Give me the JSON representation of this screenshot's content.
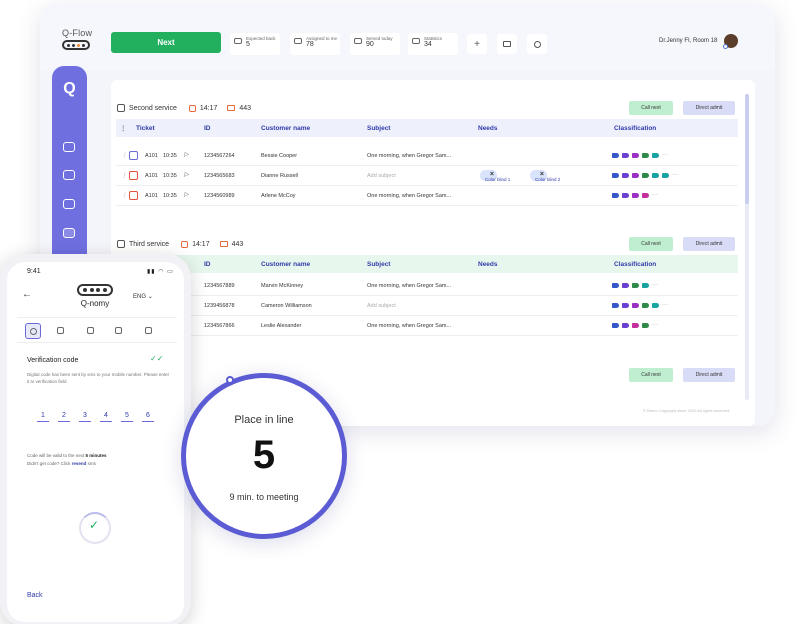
{
  "app": {
    "brand": "Q-Flow",
    "next_label": "Next",
    "stats": [
      {
        "label": "Expected back",
        "value": "5"
      },
      {
        "label": "Assigned to me",
        "value": "78"
      },
      {
        "label": "Served today",
        "value": "90"
      },
      {
        "label": "Statistics",
        "value": "34"
      }
    ],
    "plus_icon": "+",
    "user": "Dr.Jenny FI, Room 18",
    "sidebar_logo": "Q"
  },
  "services": [
    {
      "name": "Second service",
      "time": "14:17",
      "count": "443",
      "call_next": "Call next",
      "direct_admit": "Direct admit",
      "columns": [
        "Ticket",
        "ID",
        "Customer name",
        "Subject",
        "Needs",
        "Classification"
      ],
      "rows": [
        {
          "ticket": "A101",
          "time": "10:35",
          "id": "1234567264",
          "name": "Bessie Cooper",
          "subject": "One morning, when Gregor Sam...",
          "needs": []
        },
        {
          "ticket": "A101",
          "time": "10:35",
          "id": "1234565683",
          "name": "Dianne Russell",
          "subject": "Add subject",
          "needs": [
            "Color blind 1",
            "Color blind 2"
          ]
        },
        {
          "ticket": "A101",
          "time": "10:35",
          "id": "1234560989",
          "name": "Arlene McCoy",
          "subject": "One morning, when Gregor Sam...",
          "needs": []
        }
      ]
    },
    {
      "name": "Third service",
      "time": "14:17",
      "count": "443",
      "call_next": "Call next",
      "direct_admit": "Direct admit",
      "columns": [
        "ID",
        "Customer name",
        "Subject",
        "Needs",
        "Classification"
      ],
      "rows": [
        {
          "id": "1234567889",
          "name": "Marvin McKinney",
          "subject": "One morning, when Gregor Sam..."
        },
        {
          "id": "1239456878",
          "name": "Cameron Williamson",
          "subject": "Add subject"
        },
        {
          "id": "1234567866",
          "name": "Leslie Alexander",
          "subject": "One morning, when Gregor Sam..."
        }
      ]
    },
    {
      "call_next": "Call next",
      "direct_admit": "Direct admit"
    }
  ],
  "footer": "© Nemo Copyright since 2023 All rights reserved",
  "phone": {
    "time": "9:41",
    "brand": "Q-nomy",
    "language": "ENG",
    "title": "Verification code",
    "description": "Digital code has been sent by sms to your mobile number. Please enter it to verification field",
    "digits": [
      "1",
      "2",
      "3",
      "4",
      "5",
      "6"
    ],
    "valid_prefix": "Code will be valid to the next ",
    "valid_bold": "5 minutes",
    "resend_prefix": "Didn't get code? Click ",
    "resend_link": "resend",
    "resend_suffix": " sms",
    "back": "Back"
  },
  "place_in_line": {
    "label": "Place in line",
    "number": "5",
    "subtitle": "9 min. to meeting"
  },
  "colors": {
    "accent": "#5b5bd3",
    "green": "#22b05f",
    "sidebar": "#6f6fe0"
  }
}
